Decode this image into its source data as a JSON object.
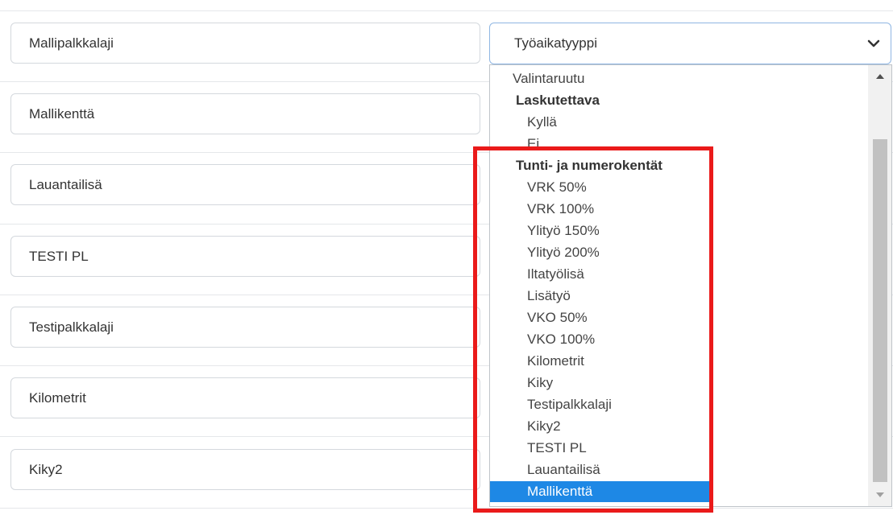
{
  "fields": [
    {
      "value": "Mallipalkkalaji"
    },
    {
      "value": "Mallikenttä"
    },
    {
      "value": "Lauantailisä"
    },
    {
      "value": "TESTI PL"
    },
    {
      "value": "Testipalkkalaji"
    },
    {
      "value": "Kilometrit"
    },
    {
      "value": "Kiky2"
    }
  ],
  "select": {
    "value": "Työaikatyyppi"
  },
  "dropdown": {
    "options": [
      {
        "label": "Valintaruutu",
        "type": "option"
      },
      {
        "label": "Laskutettava",
        "type": "group"
      },
      {
        "label": "Kyllä",
        "type": "option"
      },
      {
        "label": "Ei",
        "type": "option"
      },
      {
        "label": "Tunti- ja numerokentät",
        "type": "group"
      },
      {
        "label": "VRK 50%",
        "type": "option"
      },
      {
        "label": "VRK 100%",
        "type": "option"
      },
      {
        "label": "Ylityö 150%",
        "type": "option"
      },
      {
        "label": "Ylityö 200%",
        "type": "option"
      },
      {
        "label": "Iltatyölisä",
        "type": "option"
      },
      {
        "label": "Lisätyö",
        "type": "option"
      },
      {
        "label": "VKO 50%",
        "type": "option"
      },
      {
        "label": "VKO 100%",
        "type": "option"
      },
      {
        "label": "Kilometrit",
        "type": "option"
      },
      {
        "label": "Kiky",
        "type": "option"
      },
      {
        "label": "Testipalkkalaji",
        "type": "option"
      },
      {
        "label": "Kiky2",
        "type": "option"
      },
      {
        "label": "TESTI PL",
        "type": "option"
      },
      {
        "label": "Lauantailisä",
        "type": "option"
      },
      {
        "label": "Mallikenttä",
        "type": "option",
        "selected": true
      }
    ]
  },
  "colors": {
    "highlight": "#1e88e5",
    "annotation": "#ea1a1a",
    "select_border": "#8fb6e3"
  }
}
